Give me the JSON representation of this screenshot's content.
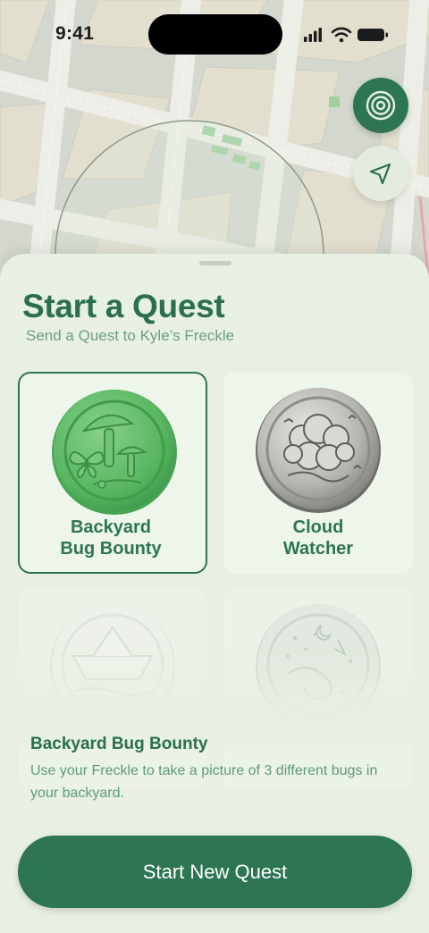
{
  "status_bar": {
    "time": "9:41",
    "icons": [
      "signal-icon",
      "wifi-icon",
      "battery-icon"
    ]
  },
  "map": {
    "buttons": [
      {
        "name": "target-icon",
        "style": "filled"
      },
      {
        "name": "location-arrow-icon",
        "style": "light"
      }
    ]
  },
  "sheet": {
    "title": "Start a Quest",
    "subtitle": "Send a Quest to Kyle’s Freckle",
    "quests": [
      {
        "label_line1": "Backyard",
        "label_line2": "Bug Bounty",
        "selected": true,
        "coin": "mushroom-butterfly-seal-icon"
      },
      {
        "label_line1": "Cloud",
        "label_line2": "Watcher",
        "selected": false,
        "coin": "cloud-seal-icon"
      },
      {
        "label_line1": "",
        "label_line2": "",
        "selected": false,
        "coin": "paper-boat-seal-icon"
      },
      {
        "label_line1": "",
        "label_line2": "",
        "selected": false,
        "coin": "night-sky-seal-icon"
      }
    ],
    "selected_title": "Backyard Bug Bounty",
    "selected_description": "Use your Freckle to take a picture of 3 different  bugs in your backyard.",
    "primary_button": "Start New Quest"
  },
  "colors": {
    "brand_green": "#2d7553",
    "sheet_bg": "#e8efe3",
    "subtitle_green": "#6aa088"
  }
}
